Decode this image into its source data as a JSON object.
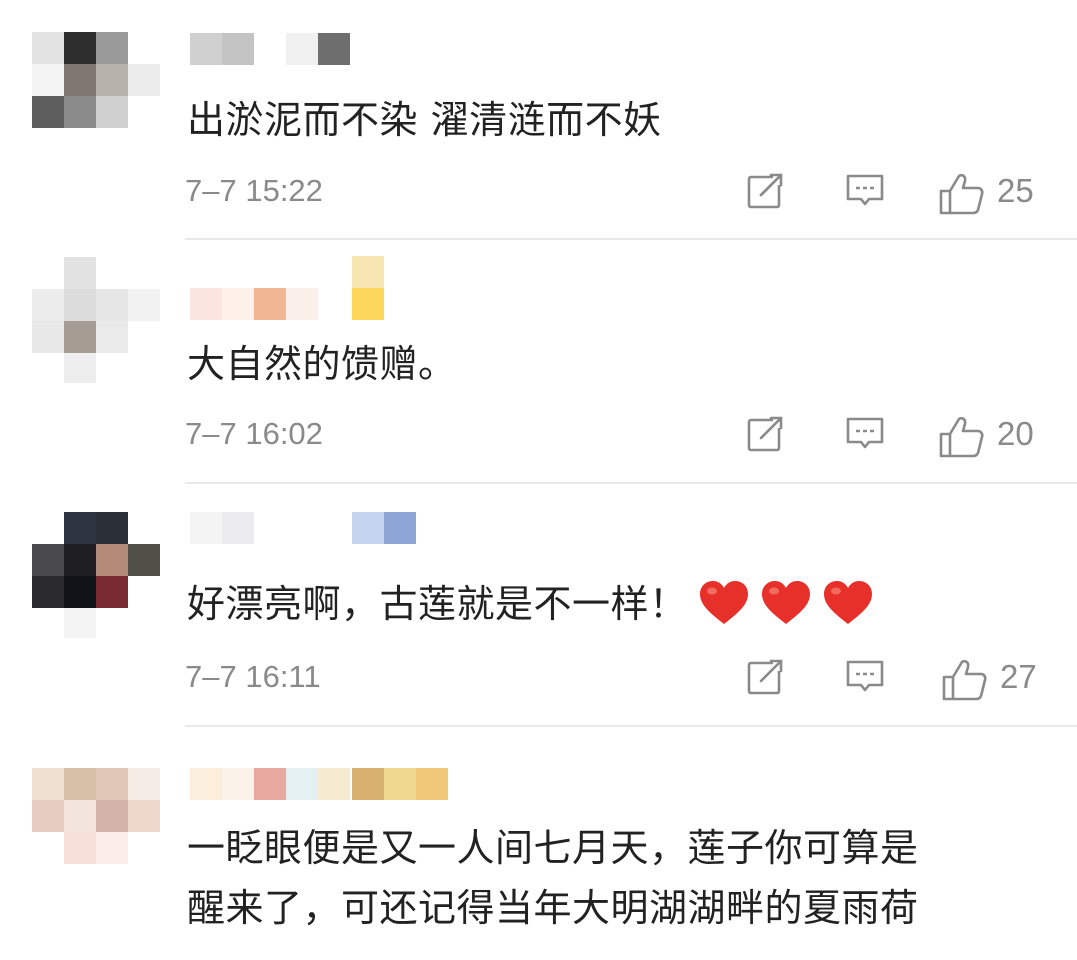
{
  "comments": [
    {
      "text": "出淤泥而不染 濯清涟而不妖",
      "time": "7–7 15:22",
      "likes": "25",
      "avatar_icon": "pixelated-avatar-icon",
      "username_hidden": true
    },
    {
      "text": "大自然的馈赠。",
      "time": "7–7 16:02",
      "likes": "20",
      "avatar_icon": "pixelated-avatar-icon",
      "username_hidden": true
    },
    {
      "text": "好漂亮啊，古莲就是不一样！",
      "time": "7–7 16:11",
      "likes": "27",
      "emoji": [
        "heart-icon",
        "heart-icon",
        "heart-icon"
      ],
      "avatar_icon": "pixelated-avatar-icon",
      "username_hidden": true
    },
    {
      "text_line1": "一眨眼便是又一人间七月天，莲子你可算是",
      "text_line2": "醒来了，可还记得当年大明湖湖畔的夏雨荷",
      "avatar_icon": "pixelated-avatar-icon",
      "username_hidden": true
    }
  ],
  "icons": {
    "share": "share-icon",
    "reply": "comment-icon",
    "like": "thumbs-up-icon"
  },
  "colors": {
    "text": "#222222",
    "meta": "#8a8a8a",
    "heart": "#e8302a",
    "divider": "#e8e8e8"
  }
}
